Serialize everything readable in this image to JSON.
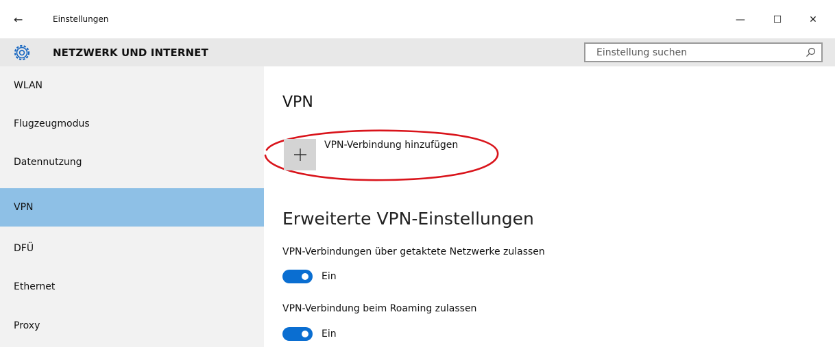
{
  "window": {
    "title": "Einstellungen",
    "back_glyph": "←",
    "minimize_glyph": "—",
    "maximize_glyph": "☐",
    "close_glyph": "✕"
  },
  "header": {
    "section_title": "NETZWERK UND INTERNET",
    "icon": "gear-icon",
    "search": {
      "placeholder": "Einstellung suchen",
      "value": "",
      "icon": "search-icon"
    }
  },
  "sidebar": {
    "items": [
      {
        "label": "WLAN",
        "active": false
      },
      {
        "label": "Flugzeugmodus",
        "active": false
      },
      {
        "label": "Datennutzung",
        "active": false
      },
      {
        "label": "VPN",
        "active": true
      },
      {
        "label": "DFÜ",
        "active": false
      },
      {
        "label": "Ethernet",
        "active": false
      },
      {
        "label": "Proxy",
        "active": false
      }
    ]
  },
  "main": {
    "title": "VPN",
    "add_connection": {
      "label": "VPN-Verbindung hinzufügen",
      "icon": "plus-icon",
      "highlight": "red-ellipse"
    },
    "advanced_title": "Erweiterte VPN-Einstellungen",
    "settings": [
      {
        "label": "VPN-Verbindungen über getaktete Netzwerke zulassen",
        "state": "Ein",
        "on": true
      },
      {
        "label": "VPN-Verbindung beim Roaming zulassen",
        "state": "Ein",
        "on": true
      }
    ]
  },
  "colors": {
    "accent": "#0a6ed1",
    "active_nav": "#8ec0e6",
    "sidebar_bg": "#f2f2f2",
    "header_bg": "#e8e8e8",
    "highlight_red": "#d9141b",
    "gear": "#1565c0"
  }
}
